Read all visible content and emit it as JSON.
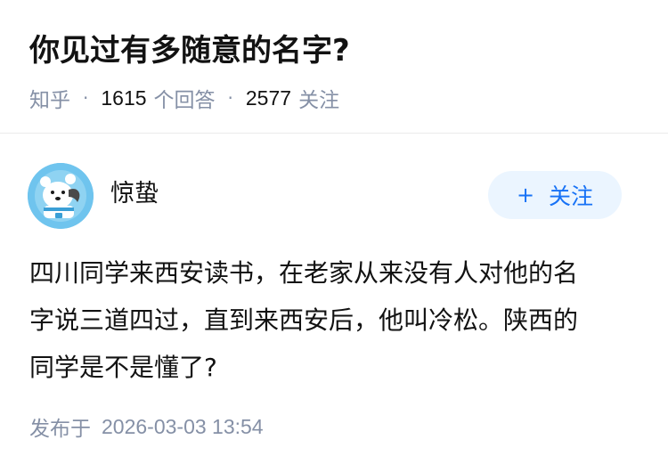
{
  "question": {
    "title": "你见过有多随意的名字?",
    "source": "知乎",
    "separator": "·",
    "answers_count": "1615",
    "answers_unit": "个回答",
    "followers_count": "2577",
    "followers_unit": "关注"
  },
  "answer": {
    "author_name": "惊蛰",
    "follow_button": {
      "icon": "+",
      "label": "关注"
    },
    "content_lines": [
      "四川同学来西安读书，在老家从来没有人对他的名",
      "字说三道四过，直到来西安后，他叫冷松。陕西的",
      "同学是不是懂了?"
    ],
    "published_label": "发布于",
    "published_time": "2026-03-03 13:54"
  },
  "colors": {
    "title_text": "#121212",
    "meta_text": "#8590a6",
    "follow_button_bg": "#ebf5ff",
    "follow_button_text": "#1772f6",
    "avatar_bg": "#6fc4ee",
    "divider": "#ebebeb"
  },
  "icons": {
    "avatar": "cartoon-bear-avatar-icon",
    "follow": "plus-icon"
  }
}
